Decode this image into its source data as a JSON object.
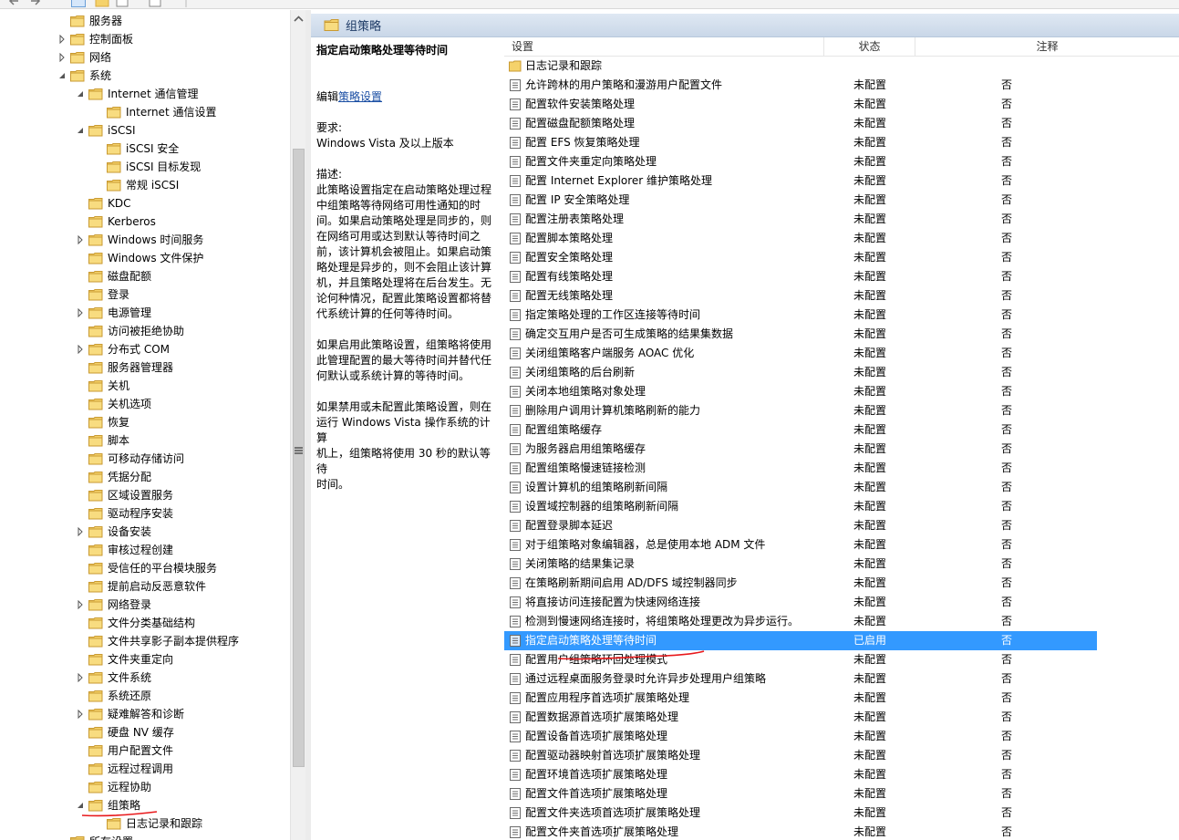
{
  "colors": {
    "folder": "#f5d26b",
    "folder_dark": "#d9a93c",
    "selection": "#3399ff",
    "annotation": "#e8191c",
    "header_text": "#1e3b66",
    "link": "#1a4ea3"
  },
  "toolbar": {
    "icons": [
      "back-icon",
      "forward-icon",
      "show-tree-icon",
      "folder-icon",
      "properties-icon",
      "help-icon"
    ]
  },
  "tree": {
    "items": [
      {
        "label": "服务器",
        "level": 3,
        "arrow": "none"
      },
      {
        "label": "控制面板",
        "level": 3,
        "arrow": "collapsed"
      },
      {
        "label": "网络",
        "level": 3,
        "arrow": "collapsed"
      },
      {
        "label": "系统",
        "level": 3,
        "arrow": "expanded"
      },
      {
        "label": "Internet 通信管理",
        "level": 4,
        "arrow": "expanded"
      },
      {
        "label": "Internet 通信设置",
        "level": 5,
        "arrow": "none"
      },
      {
        "label": "iSCSI",
        "level": 4,
        "arrow": "expanded"
      },
      {
        "label": "iSCSI 安全",
        "level": 5,
        "arrow": "none"
      },
      {
        "label": "iSCSI 目标发现",
        "level": 5,
        "arrow": "none"
      },
      {
        "label": "常规 iSCSI",
        "level": 5,
        "arrow": "none"
      },
      {
        "label": "KDC",
        "level": 4,
        "arrow": "none"
      },
      {
        "label": "Kerberos",
        "level": 4,
        "arrow": "none"
      },
      {
        "label": "Windows 时间服务",
        "level": 4,
        "arrow": "collapsed"
      },
      {
        "label": "Windows 文件保护",
        "level": 4,
        "arrow": "none"
      },
      {
        "label": "磁盘配额",
        "level": 4,
        "arrow": "none"
      },
      {
        "label": "登录",
        "level": 4,
        "arrow": "none"
      },
      {
        "label": "电源管理",
        "level": 4,
        "arrow": "collapsed"
      },
      {
        "label": "访问被拒绝协助",
        "level": 4,
        "arrow": "none"
      },
      {
        "label": "分布式 COM",
        "level": 4,
        "arrow": "collapsed"
      },
      {
        "label": "服务器管理器",
        "level": 4,
        "arrow": "none"
      },
      {
        "label": "关机",
        "level": 4,
        "arrow": "none"
      },
      {
        "label": "关机选项",
        "level": 4,
        "arrow": "none"
      },
      {
        "label": "恢复",
        "level": 4,
        "arrow": "none"
      },
      {
        "label": "脚本",
        "level": 4,
        "arrow": "none"
      },
      {
        "label": "可移动存储访问",
        "level": 4,
        "arrow": "none"
      },
      {
        "label": "凭据分配",
        "level": 4,
        "arrow": "none"
      },
      {
        "label": "区域设置服务",
        "level": 4,
        "arrow": "none"
      },
      {
        "label": "驱动程序安装",
        "level": 4,
        "arrow": "none"
      },
      {
        "label": "设备安装",
        "level": 4,
        "arrow": "collapsed"
      },
      {
        "label": "审核过程创建",
        "level": 4,
        "arrow": "none"
      },
      {
        "label": "受信任的平台模块服务",
        "level": 4,
        "arrow": "none"
      },
      {
        "label": "提前启动反恶意软件",
        "level": 4,
        "arrow": "none"
      },
      {
        "label": "网络登录",
        "level": 4,
        "arrow": "collapsed"
      },
      {
        "label": "文件分类基础结构",
        "level": 4,
        "arrow": "none"
      },
      {
        "label": "文件共享影子副本提供程序",
        "level": 4,
        "arrow": "none"
      },
      {
        "label": "文件夹重定向",
        "level": 4,
        "arrow": "none"
      },
      {
        "label": "文件系统",
        "level": 4,
        "arrow": "collapsed"
      },
      {
        "label": "系统还原",
        "level": 4,
        "arrow": "none"
      },
      {
        "label": "疑难解答和诊断",
        "level": 4,
        "arrow": "collapsed"
      },
      {
        "label": "硬盘 NV 缓存",
        "level": 4,
        "arrow": "none"
      },
      {
        "label": "用户配置文件",
        "level": 4,
        "arrow": "none"
      },
      {
        "label": "远程过程调用",
        "level": 4,
        "arrow": "none"
      },
      {
        "label": "远程协助",
        "level": 4,
        "arrow": "none"
      },
      {
        "label": "组策略",
        "level": 4,
        "arrow": "expanded",
        "selected": true
      },
      {
        "label": "日志记录和跟踪",
        "level": 5,
        "arrow": "none"
      },
      {
        "label": "所有设置",
        "level": 3,
        "arrow": "none"
      }
    ]
  },
  "header": {
    "title": "组策略"
  },
  "description": {
    "title": "指定启动策略处理等待时间",
    "edit_prefix": "编辑",
    "edit_link": "策略设置",
    "requirements_label": "要求:",
    "requirements_value": "Windows Vista 及以上版本",
    "desc_label": "描述:",
    "lines1": [
      "此策略设置指定在启动策略处理过程",
      "中组策略等待网络可用性通知的时",
      "间。如果启动策略处理是同步的，则",
      "在网络可用或达到默认等待时间之",
      "前，该计算机会被阻止。如果启动策",
      "略处理是异步的，则不会阻止该计算",
      "机，并且策略处理将在后台发生。无",
      "论何种情况，配置此策略设置都将替",
      "代系统计算的任何等待时间。"
    ],
    "lines2": [
      "如果启用此策略设置，组策略将使用",
      "此管理配置的最大等待时间并替代任",
      "何默认或系统计算的等待时间。"
    ],
    "lines3": [
      "如果禁用或未配置此策略设置，则在",
      "运行 Windows Vista 操作系统的计算",
      "机上，组策略将使用 30 秒的默认等待",
      "时间。"
    ]
  },
  "list": {
    "columns": {
      "setting": "设置",
      "state": "状态",
      "comment": "注释"
    },
    "folder_row": "日志记录和跟踪",
    "rows": [
      {
        "setting": "允许跨林的用户策略和漫游用户配置文件",
        "state": "未配置",
        "comment": "否"
      },
      {
        "setting": "配置软件安装策略处理",
        "state": "未配置",
        "comment": "否"
      },
      {
        "setting": "配置磁盘配额策略处理",
        "state": "未配置",
        "comment": "否"
      },
      {
        "setting": "配置 EFS 恢复策略处理",
        "state": "未配置",
        "comment": "否"
      },
      {
        "setting": "配置文件夹重定向策略处理",
        "state": "未配置",
        "comment": "否"
      },
      {
        "setting": "配置 Internet Explorer 维护策略处理",
        "state": "未配置",
        "comment": "否"
      },
      {
        "setting": "配置 IP 安全策略处理",
        "state": "未配置",
        "comment": "否"
      },
      {
        "setting": "配置注册表策略处理",
        "state": "未配置",
        "comment": "否"
      },
      {
        "setting": "配置脚本策略处理",
        "state": "未配置",
        "comment": "否"
      },
      {
        "setting": "配置安全策略处理",
        "state": "未配置",
        "comment": "否"
      },
      {
        "setting": "配置有线策略处理",
        "state": "未配置",
        "comment": "否"
      },
      {
        "setting": "配置无线策略处理",
        "state": "未配置",
        "comment": "否"
      },
      {
        "setting": "指定策略处理的工作区连接等待时间",
        "state": "未配置",
        "comment": "否"
      },
      {
        "setting": "确定交互用户是否可生成策略的结果集数据",
        "state": "未配置",
        "comment": "否"
      },
      {
        "setting": "关闭组策略客户端服务 AOAC 优化",
        "state": "未配置",
        "comment": "否"
      },
      {
        "setting": "关闭组策略的后台刷新",
        "state": "未配置",
        "comment": "否"
      },
      {
        "setting": "关闭本地组策略对象处理",
        "state": "未配置",
        "comment": "否"
      },
      {
        "setting": "删除用户调用计算机策略刷新的能力",
        "state": "未配置",
        "comment": "否"
      },
      {
        "setting": "配置组策略缓存",
        "state": "未配置",
        "comment": "否"
      },
      {
        "setting": "为服务器启用组策略缓存",
        "state": "未配置",
        "comment": "否"
      },
      {
        "setting": "配置组策略慢速链接检测",
        "state": "未配置",
        "comment": "否"
      },
      {
        "setting": "设置计算机的组策略刷新间隔",
        "state": "未配置",
        "comment": "否"
      },
      {
        "setting": "设置域控制器的组策略刷新间隔",
        "state": "未配置",
        "comment": "否"
      },
      {
        "setting": "配置登录脚本延迟",
        "state": "未配置",
        "comment": "否"
      },
      {
        "setting": "对于组策略对象编辑器，总是使用本地 ADM 文件",
        "state": "未配置",
        "comment": "否"
      },
      {
        "setting": "关闭策略的结果集记录",
        "state": "未配置",
        "comment": "否"
      },
      {
        "setting": "在策略刷新期间启用 AD/DFS 域控制器同步",
        "state": "未配置",
        "comment": "否"
      },
      {
        "setting": "将直接访问连接配置为快速网络连接",
        "state": "未配置",
        "comment": "否"
      },
      {
        "setting": "检测到慢速网络连接时，将组策略处理更改为异步运行。",
        "state": "未配置",
        "comment": "否"
      },
      {
        "setting": "指定启动策略处理等待时间",
        "state": "已启用",
        "comment": "否",
        "selected": true
      },
      {
        "setting": "配置用户组策略环回处理模式",
        "state": "未配置",
        "comment": "否"
      },
      {
        "setting": "通过远程桌面服务登录时允许异步处理用户组策略",
        "state": "未配置",
        "comment": "否"
      },
      {
        "setting": "配置应用程序首选项扩展策略处理",
        "state": "未配置",
        "comment": "否"
      },
      {
        "setting": "配置数据源首选项扩展策略处理",
        "state": "未配置",
        "comment": "否"
      },
      {
        "setting": "配置设备首选项扩展策略处理",
        "state": "未配置",
        "comment": "否"
      },
      {
        "setting": "配置驱动器映射首选项扩展策略处理",
        "state": "未配置",
        "comment": "否"
      },
      {
        "setting": "配置环境首选项扩展策略处理",
        "state": "未配置",
        "comment": "否"
      },
      {
        "setting": "配置文件首选项扩展策略处理",
        "state": "未配置",
        "comment": "否"
      },
      {
        "setting": "配置文件夹选项首选项扩展策略处理",
        "state": "未配置",
        "comment": "否"
      },
      {
        "setting": "配置文件夹首选项扩展策略处理",
        "state": "未配置",
        "comment": "否"
      }
    ]
  }
}
